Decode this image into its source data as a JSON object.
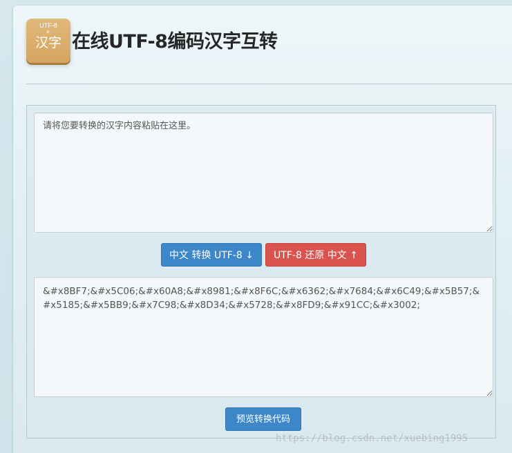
{
  "header": {
    "logo_small": "UTF-8",
    "logo_chevron": "»",
    "logo_big": "汉字",
    "title": "在线UTF-8编码汉字互转"
  },
  "input": {
    "value": "请将您要转换的汉字内容粘贴在这里。"
  },
  "buttons": {
    "to_utf8": "中文 转换 UTF-8 ↓",
    "to_chinese": "UTF-8 还原 中文 ↑",
    "preview": "预览转换代码"
  },
  "output": {
    "value": "&#x8BF7;&#x5C06;&#x60A8;&#x8981;&#x8F6C;&#x6362;&#x7684;&#x6C49;&#x5B57;&#x5185;&#x5BB9;&#x7C98;&#x8D34;&#x5728;&#x8FD9;&#x91CC;&#x3002;"
  },
  "watermark": "https://blog.csdn.net/xuebing1995",
  "colors": {
    "primary": "#3d87c9",
    "danger": "#d9534f",
    "logo": "#d4a562"
  }
}
